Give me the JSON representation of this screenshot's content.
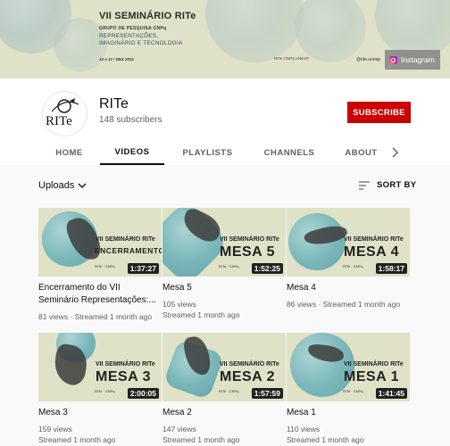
{
  "banner": {
    "title": "VII SEMINÁRIO RITe",
    "subtitle": "GRUPO DE PESQUISA CNPq",
    "line1": "REPRESENTAÇÕES,",
    "line2": "IMAGINÁRIO E TECNOLOGIA",
    "dates": "13 a 17 / DEZ 2021",
    "logos": "RITe   CNPq   UNESP",
    "handle": "@rite.unesp",
    "instagram_label": "Instagram"
  },
  "channel": {
    "avatar_text": "RITe",
    "name": "RITe",
    "subscribers": "148 subscribers",
    "subscribe_label": "SUBSCRIBE"
  },
  "tabs": [
    "HOME",
    "VIDEOS",
    "PLAYLISTS",
    "CHANNELS",
    "ABOUT"
  ],
  "active_tab": "VIDEOS",
  "toolbar": {
    "uploads_label": "Uploads",
    "sort_label": "SORT BY"
  },
  "colors": {
    "subscribe": "#cc0000",
    "thumb_bg": "#dfe2c6",
    "bubble": "#6fb2b8"
  },
  "videos": [
    {
      "title": "Encerramento do VII Seminário Representações:...",
      "thumb_seminar": "VII SEMINÁRIO RITe",
      "thumb_label": "ENCERRAMENTO",
      "duration": "1:37:27",
      "views": "81 views",
      "date": "Streamed 1 month ago"
    },
    {
      "title": "Mesa 5",
      "thumb_seminar": "VII SEMINÁRIO RITe",
      "thumb_label": "MESA 5",
      "duration": "1:52:25",
      "views": "105 views",
      "date": "Streamed 1 month ago"
    },
    {
      "title": "Mesa 4",
      "thumb_seminar": "VII SEMINÁRIO RITe",
      "thumb_label": "MESA 4",
      "duration": "1:58:17",
      "views": "86 views",
      "date": "Streamed 1 month ago"
    },
    {
      "title": "Mesa 3",
      "thumb_seminar": "VII SEMINÁRIO RITe",
      "thumb_label": "MESA 3",
      "duration": "2:00:05",
      "views": "159 views",
      "date": "Streamed 1 month ago"
    },
    {
      "title": "Mesa 2",
      "thumb_seminar": "VII SEMINÁRIO RITe",
      "thumb_label": "MESA 2",
      "duration": "1:57:59",
      "views": "147 views",
      "date": "Streamed 1 month ago"
    },
    {
      "title": "Mesa 1",
      "thumb_seminar": "VII SEMINÁRIO RITe",
      "thumb_label": "MESA 1",
      "duration": "1:41:45",
      "views": "110 views",
      "date": "Streamed 1 month ago"
    }
  ]
}
